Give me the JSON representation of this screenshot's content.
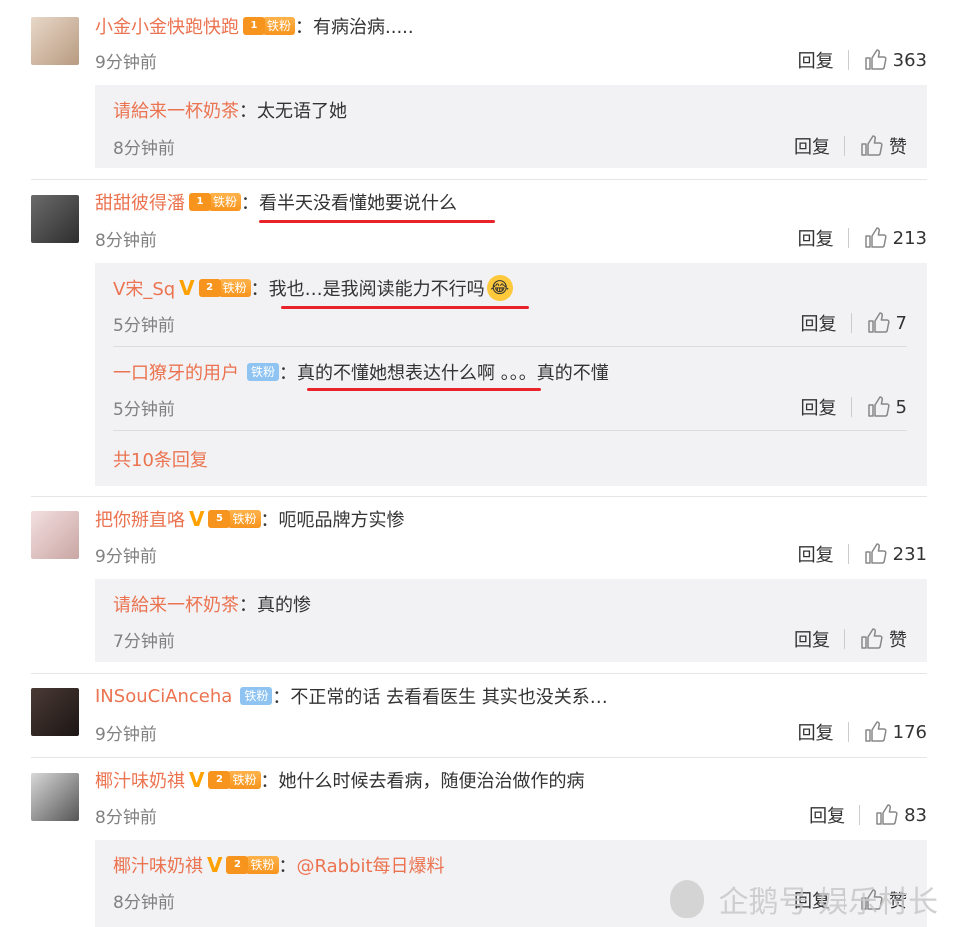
{
  "comments": [
    {
      "user": "小金小金快跑快跑",
      "fan_level": "1",
      "fan_label": "铁粉",
      "text": "：有病治病.....",
      "time": "9分钟前",
      "reply_label": "回复",
      "likes": "363",
      "replies": [
        {
          "user": "请給来一杯奶茶",
          "text": "：太无语了她",
          "time": "8分钟前",
          "reply_label": "回复",
          "likes": "赞"
        }
      ]
    },
    {
      "user": "甜甜彼得潘",
      "fan_level": "1",
      "fan_label": "铁粉",
      "text": "：看半天没看懂她要说什么",
      "time": "8分钟前",
      "reply_label": "回复",
      "likes": "213",
      "replies": [
        {
          "user": "V宋_Sq",
          "fan_level": "2",
          "fan_label": "铁粉",
          "text": "：我也…是我阅读能力不行吗",
          "time": "5分钟前",
          "reply_label": "回复",
          "likes": "7"
        },
        {
          "user": "一口獠牙的用户",
          "fan_label": "铁粉",
          "text": "：真的不懂她想表达什么啊 。。。真的不懂",
          "time": "5分钟前",
          "reply_label": "回复",
          "likes": "5"
        }
      ],
      "more": "共10条回复"
    },
    {
      "user": "把你掰直咯",
      "fan_level": "5",
      "fan_label": "铁粉",
      "text": "：呃呃品牌方实惨",
      "time": "9分钟前",
      "reply_label": "回复",
      "likes": "231",
      "replies": [
        {
          "user": "请給来一杯奶茶",
          "text": "：真的惨",
          "time": "7分钟前",
          "reply_label": "回复",
          "likes": "赞"
        }
      ]
    },
    {
      "user": "INSouCiAnceha",
      "fan_label": "铁粉",
      "text": "：不正常的话 去看看医生 其实也没关系…",
      "time": "9分钟前",
      "reply_label": "回复",
      "likes": "176"
    },
    {
      "user": "椰汁味奶祺",
      "fan_level": "2",
      "fan_label": "铁粉",
      "text": "：她什么时候去看病，随便治治做作的病",
      "time": "8分钟前",
      "reply_label": "回复",
      "likes": "83",
      "replies": [
        {
          "user": "椰汁味奶祺",
          "fan_level": "2",
          "fan_label": "铁粉",
          "text": "：",
          "mention": "@Rabbit每日爆料",
          "time": "8分钟前",
          "reply_label": "回复",
          "likes": "赞"
        }
      ]
    }
  ],
  "watermark": "企鹅号 娱乐村长",
  "colors": {
    "username": "#eb7350",
    "underline": "#e8242a",
    "reply_bg": "#f2f2f5"
  }
}
